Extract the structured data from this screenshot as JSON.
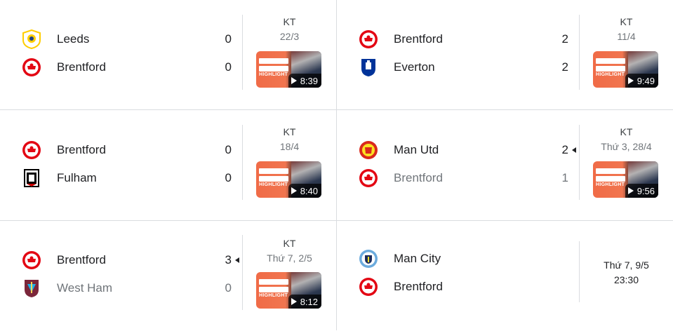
{
  "matches": [
    {
      "home": {
        "name": "Leeds",
        "score": "0",
        "logo": "leeds-logo",
        "loser": false
      },
      "away": {
        "name": "Brentford",
        "score": "0",
        "logo": "brentford-logo",
        "loser": false
      },
      "status": "KT",
      "date": "22/3",
      "duration": "8:39",
      "winner": ""
    },
    {
      "home": {
        "name": "Brentford",
        "score": "2",
        "logo": "brentford-logo",
        "loser": false
      },
      "away": {
        "name": "Everton",
        "score": "2",
        "logo": "everton-logo",
        "loser": false
      },
      "status": "KT",
      "date": "11/4",
      "duration": "9:49",
      "winner": ""
    },
    {
      "home": {
        "name": "Brentford",
        "score": "0",
        "logo": "brentford-logo",
        "loser": false
      },
      "away": {
        "name": "Fulham",
        "score": "0",
        "logo": "fulham-logo",
        "loser": false
      },
      "status": "KT",
      "date": "18/4",
      "duration": "8:40",
      "winner": ""
    },
    {
      "home": {
        "name": "Man Utd",
        "score": "2",
        "logo": "man-utd-logo",
        "loser": false
      },
      "away": {
        "name": "Brentford",
        "score": "1",
        "logo": "brentford-logo",
        "loser": true
      },
      "status": "KT",
      "date": "Thứ 3, 28/4",
      "duration": "9:56",
      "winner": "home"
    },
    {
      "home": {
        "name": "Brentford",
        "score": "3",
        "logo": "brentford-logo",
        "loser": false
      },
      "away": {
        "name": "West Ham",
        "score": "0",
        "logo": "west-ham-logo",
        "loser": true
      },
      "status": "KT",
      "date": "Thứ 7, 2/5",
      "duration": "8:12",
      "winner": "home"
    },
    {
      "home": {
        "name": "Man City",
        "logo": "man-city-logo"
      },
      "away": {
        "name": "Brentford",
        "logo": "brentford-logo"
      },
      "date": "Thứ 7, 9/5",
      "time": "23:30"
    }
  ],
  "thumb_labels": {
    "highlight": "HIGHLIGHT"
  },
  "colors": {
    "brentford_red": "#e30613",
    "leeds_yellow": "#ffcd00",
    "leeds_blue": "#1d428a",
    "everton_blue": "#003399",
    "man_utd_red": "#da291c",
    "west_ham_claret": "#7a263a",
    "man_city_blue": "#6cabdd",
    "thumb_orange": "#f06b47"
  }
}
